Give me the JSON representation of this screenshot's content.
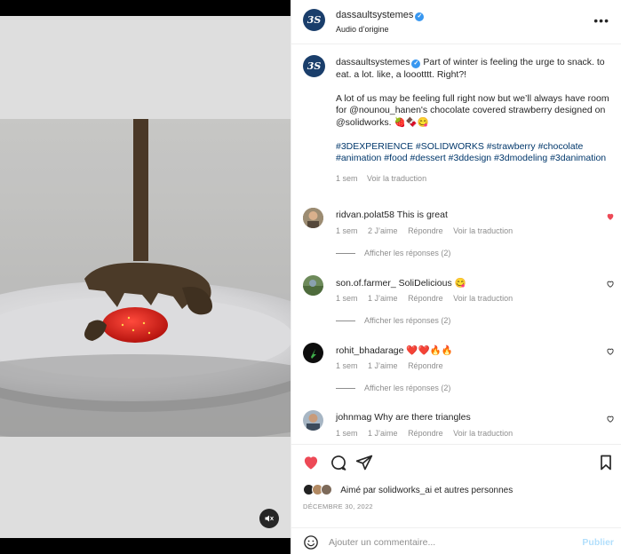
{
  "header": {
    "username": "dassaultsystemes",
    "subtitle": "Audio d’origine",
    "avatar_text": "3S"
  },
  "caption": {
    "username": "dassaultsystemes",
    "line1": "Part of winter is feeling the urge to snack. to eat. a lot. like, a loootttt. Right?!",
    "line2": "A lot of us may be feeling full right now but we’ll always have room for @nounou_hanen's chocolate covered strawberry designed on @solidworks. 🍓🍫😋",
    "hashtags": "#3DEXPERIENCE #SOLIDWORKS #strawberry #chocolate #animation #food #dessert #3ddesign #3dmodeling #3danimation",
    "time": "1 sem",
    "translate": "Voir la traduction"
  },
  "comments": [
    {
      "name": "ridvan.polat58",
      "text": "This is great",
      "time": "1 sem",
      "likes": "2 J’aime",
      "reply": "Répondre",
      "translate": "Voir la traduction",
      "replies": "Afficher les réponses (2)",
      "liked": true
    },
    {
      "name": "son.of.farmer_",
      "text": "SoliDelicious 😋",
      "time": "1 sem",
      "likes": "1 J’aime",
      "reply": "Répondre",
      "translate": "Voir la traduction",
      "replies": "Afficher les réponses (2)",
      "liked": false
    },
    {
      "name": "rohit_bhadarage",
      "text": "❤️❤️🔥🔥",
      "time": "1 sem",
      "likes": "1 J’aime",
      "reply": "Répondre",
      "translate": "",
      "replies": "Afficher les réponses (2)",
      "liked": false
    },
    {
      "name": "johnmag",
      "text": "Why are there triangles",
      "time": "1 sem",
      "likes": "1 J’aime",
      "reply": "Répondre",
      "translate": "Voir la traduction",
      "replies": "",
      "liked": false
    }
  ],
  "likes": {
    "prefix": "Aimé par",
    "user": "solidworks_ai",
    "suffix": "et autres personnes"
  },
  "date": "DÉCEMBRE 30, 2022",
  "add_comment": {
    "placeholder": "Ajouter un commentaire...",
    "post": "Publier"
  },
  "colors": {
    "like_red": "#ed4956",
    "link_blue": "#00376b",
    "brand_navy": "#1a3e6b",
    "muted": "#8e8e8e"
  },
  "icons": [
    "mute-icon",
    "more-icon",
    "heart-icon",
    "comment-icon",
    "share-icon",
    "bookmark-icon",
    "emoji-icon",
    "verified-icon"
  ]
}
